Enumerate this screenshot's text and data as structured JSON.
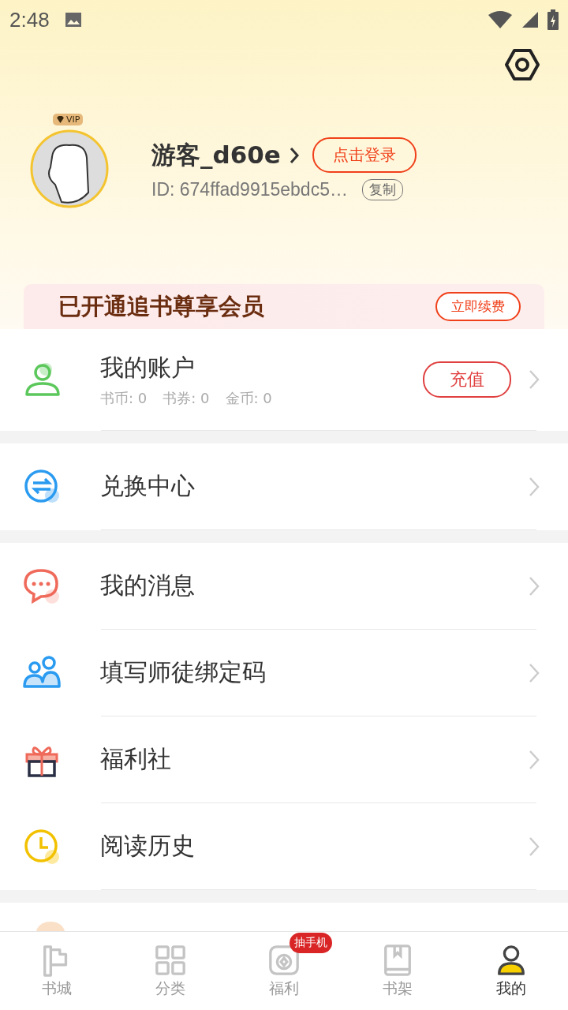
{
  "status_bar": {
    "time": "2:48"
  },
  "profile": {
    "vip_badge": "VIP",
    "name": "游客_d60e",
    "login_button": "点击登录",
    "id": "ID: 674ffad9915ebdc5…",
    "copy_button": "复制"
  },
  "vip_banner": {
    "title": "已开通追书尊享会员",
    "button": "立即续费"
  },
  "account": {
    "title": "我的账户",
    "balances": [
      "书币: 0",
      "书券: 0",
      "金币: 0"
    ],
    "button": "充值"
  },
  "menu_groups": [
    [
      {
        "label": "兑换中心",
        "kind": "exchange"
      }
    ],
    [
      {
        "label": "我的消息",
        "kind": "message"
      },
      {
        "label": "填写师徒绑定码",
        "kind": "people"
      },
      {
        "label": "福利社",
        "kind": "gift"
      },
      {
        "label": "阅读历史",
        "kind": "clock"
      }
    ]
  ],
  "nav": [
    {
      "label": "书城",
      "kind": "flag",
      "selected": false
    },
    {
      "label": "分类",
      "kind": "grid",
      "selected": false
    },
    {
      "label": "福利",
      "kind": "camera",
      "selected": false,
      "badge": "抽手机"
    },
    {
      "label": "书架",
      "kind": "book",
      "selected": false
    },
    {
      "label": "我的",
      "kind": "person",
      "selected": true
    }
  ]
}
